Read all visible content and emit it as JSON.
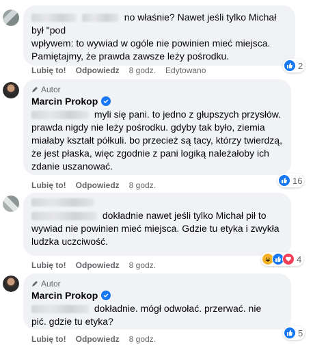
{
  "comments": [
    {
      "text": "no właśnie? Nawet jeśli tylko Michał był \"pod wpływem: to wywiad w ogóle nie powinien mieć miejsca. Pamiętajmy, że prawda zawsze leży pośrodku.",
      "text_l1": "no właśnie? Nawet jeśli tylko Michał był \"pod",
      "text_l2": "wpływem: to wywiad w ogóle nie powinien mieć miejsca.",
      "text_l3": "Pamiętajmy, że prawda zawsze leży pośrodku.",
      "like": "Lubię to!",
      "reply": "Odpowiedz",
      "time": "8 godz.",
      "edited": "Edytowano",
      "reactions_count": "2",
      "reaction_icons": [
        "like-icon"
      ]
    },
    {
      "author_badge": "Autor",
      "author": "Marcin Prokop",
      "text_l1": "myli się pani. to jedno z głupszych przysłów.",
      "text_l2": "prawda nigdy nie leży pośrodku. gdyby tak było, ziemia",
      "text_l3": "miałaby kształt półkuli. bo przecież są tacy, którzy twierdzą,",
      "text_l4": "że jest płaska, więc zgodnie z pani logiką należałoby ich",
      "text_l5": "zdanie uszanować.",
      "like": "Lubię to!",
      "reply": "Odpowiedz",
      "time": "8 godz.",
      "reactions_count": "16",
      "reaction_icons": [
        "like-icon"
      ]
    },
    {
      "text_l1": "dokładnie nawet jeśli tylko Michał pił to",
      "text_l2": "wywiad nie powinien mieć miejsca. Gdzie tu etyka i zwykła",
      "text_l3": "ludzka uczciwość.",
      "like": "Lubię to!",
      "reply": "Odpowiedz",
      "time": "8 godz.",
      "reactions_count": "4",
      "reaction_icons": [
        "haha-icon",
        "like-icon",
        "love-icon"
      ]
    },
    {
      "author_badge": "Autor",
      "author": "Marcin Prokop",
      "text_l1": "dokładnie. mógł odwołać. przerwać. nie",
      "text_l2": "pić. gdzie tu etyka?",
      "like": "Lubię to!",
      "reply": "Odpowiedz",
      "time": "8 godz.",
      "reactions_count": "5",
      "reaction_icons": [
        "like-icon"
      ]
    }
  ],
  "colors": {
    "bubble": "#f0f2f5",
    "meta": "#65676b",
    "like_blue": "#1877f2"
  }
}
